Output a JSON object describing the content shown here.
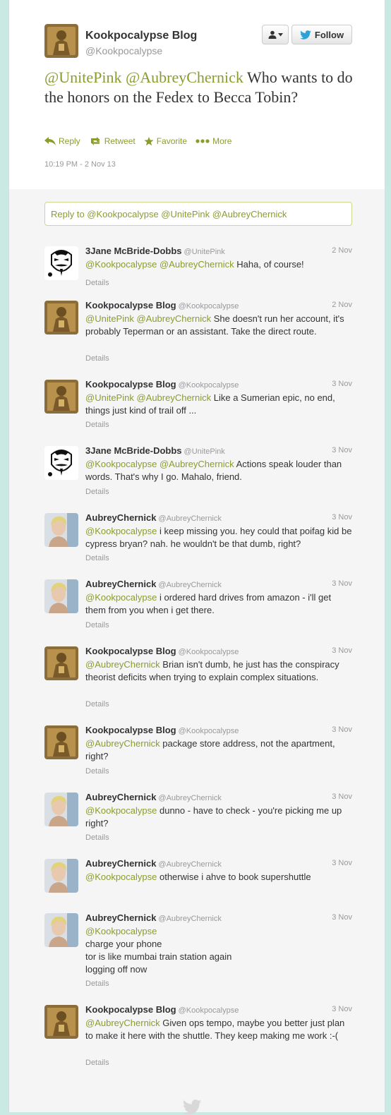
{
  "author": {
    "name": "Kookpocalypse Blog",
    "handle": "@Kookpocalypse"
  },
  "buttons": {
    "user_menu_icon": "person-icon",
    "follow_label": "Follow"
  },
  "tweet": {
    "mention_1": "@UnitePink",
    "mention_2": "@AubreyChernick",
    "text": " Who wants to do the honors on the Fedex to Becca Tobin?",
    "timestamp": "10:19 PM - 2 Nov 13"
  },
  "actions": {
    "reply": "Reply",
    "retweet": "Retweet",
    "favorite": "Favorite",
    "more": "More"
  },
  "reply_box": {
    "placeholder": "Reply to @Kookpocalypse @UnitePink @AubreyChernick"
  },
  "details_label": "Details",
  "replies": [
    {
      "name": "3Jane McBride-Dobbs",
      "handle": "@UnitePink",
      "date": "2 Nov",
      "mentions": "@Kookpocalypse @AubreyChernick",
      "text": " Haha, of course!",
      "avatar": "mask"
    },
    {
      "name": "Kookpocalypse Blog",
      "handle": "@Kookpocalypse",
      "date": "2 Nov",
      "mentions": "@UnitePink @AubreyChernick",
      "text": " She doesn't run her account, it's probably Teperman or an assistant. Take the direct route.",
      "avatar": "gold"
    },
    {
      "name": "Kookpocalypse Blog",
      "handle": "@Kookpocalypse",
      "date": "3 Nov",
      "mentions": "@UnitePink @AubreyChernick",
      "text": " Like a Sumerian epic, no end, things just kind of trail off ...",
      "avatar": "gold"
    },
    {
      "name": "3Jane McBride-Dobbs",
      "handle": "@UnitePink",
      "date": "3 Nov",
      "mentions": "@Kookpocalypse @AubreyChernick",
      "text": " Actions speak louder than words. That's why I go. Mahalo, friend.",
      "avatar": "mask"
    },
    {
      "name": "AubreyChernick",
      "handle": "@AubreyChernick",
      "date": "3 Nov",
      "mentions": "@Kookpocalypse",
      "text": " i keep missing you. hey could that poifag kid be cypress bryan? nah. he wouldn't be that dumb, right?",
      "avatar": "photo"
    },
    {
      "name": "AubreyChernick",
      "handle": "@AubreyChernick",
      "date": "3 Nov",
      "mentions": "@Kookpocalypse",
      "text": " i ordered hard drives from amazon - i'll get them from you when i get there.",
      "avatar": "photo"
    },
    {
      "name": "Kookpocalypse Blog",
      "handle": "@Kookpocalypse",
      "date": "3 Nov",
      "mentions": "@AubreyChernick",
      "text": " Brian isn't dumb, he just has the conspiracy theorist deficits when trying to explain complex situations.",
      "avatar": "gold"
    },
    {
      "name": "Kookpocalypse Blog",
      "handle": "@Kookpocalypse",
      "date": "3 Nov",
      "mentions": "@AubreyChernick",
      "text": " package store address, not the apartment, right?",
      "avatar": "gold"
    },
    {
      "name": "AubreyChernick",
      "handle": "@AubreyChernick",
      "date": "3 Nov",
      "mentions": "@Kookpocalypse",
      "text": " dunno - have to check  - you're picking me up right?",
      "avatar": "photo"
    },
    {
      "name": "AubreyChernick",
      "handle": "@AubreyChernick",
      "date": "3 Nov",
      "mentions": "@Kookpocalypse",
      "text": " otherwise i ahve to book supershuttle",
      "avatar": "photo"
    },
    {
      "name": "AubreyChernick",
      "handle": "@AubreyChernick",
      "date": "3 Nov",
      "mentions": "@Kookpocalypse",
      "text": "\ncharge your phone\ntor is like mumbai train station again\nlogging off now",
      "avatar": "photo"
    },
    {
      "name": "Kookpocalypse Blog",
      "handle": "@Kookpocalypse",
      "date": "3 Nov",
      "mentions": "@AubreyChernick",
      "text": " Given ops tempo, maybe you better just plan to make it here with the shuttle. They keep making me work :-(",
      "avatar": "gold"
    }
  ],
  "colors": {
    "link": "#8a9d2c",
    "background": "#c9e9e3",
    "twitter_blue": "#2fa1d6"
  }
}
